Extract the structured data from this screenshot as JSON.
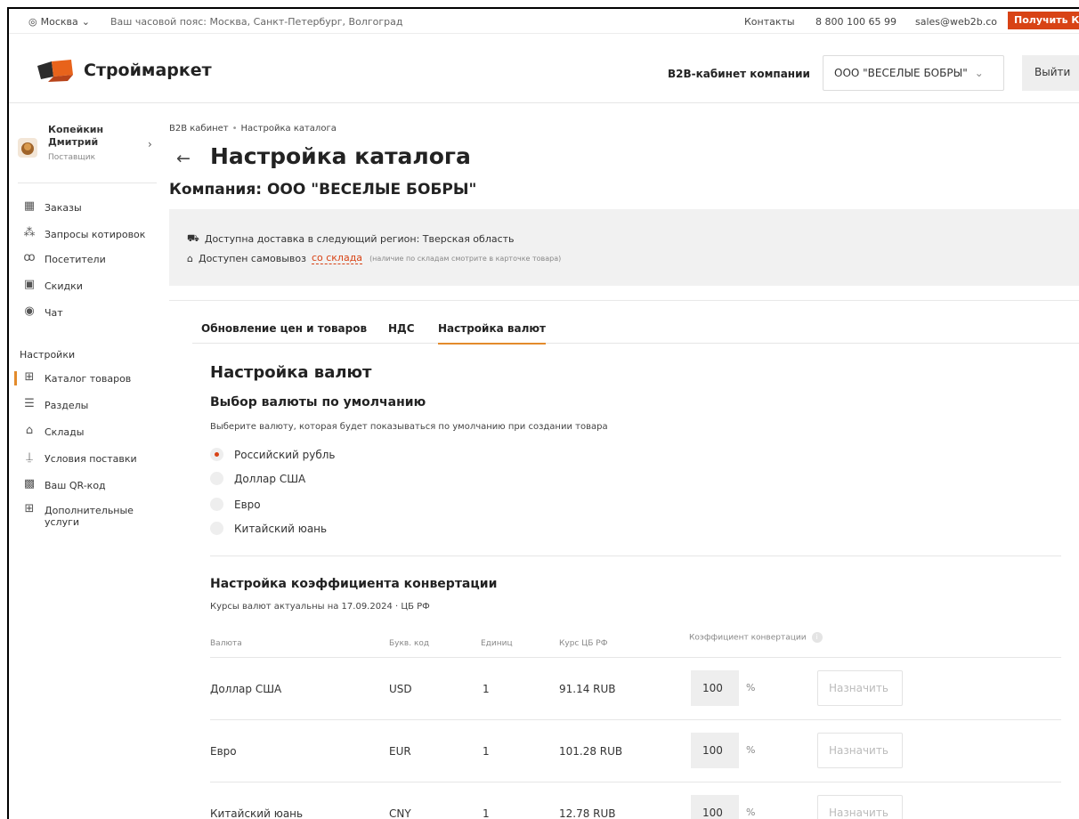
{
  "topbar": {
    "city": "Москва",
    "timezone": "Ваш часовой пояс: Москва, Санкт-Петербург, Волгоград",
    "contacts": "Контакты",
    "phone": "8 800 100 65 99",
    "email": "sales@web2b.co",
    "get_quote": "Получить КП"
  },
  "header": {
    "brand": "Строймаркет",
    "cabinet_label": "B2B-кабинет компании",
    "company_select": "ООО \"ВЕСЕЛЫЕ БОБРЫ\"",
    "logout": "Выйти"
  },
  "sidebar": {
    "user_name": "Копейкин Дмитрий",
    "user_role": "Поставщик",
    "main_items": [
      {
        "label": "Заказы",
        "icon": "orders-icon"
      },
      {
        "label": "Запросы котировок",
        "icon": "quotes-icon"
      },
      {
        "label": "Посетители",
        "icon": "visitors-icon"
      },
      {
        "label": "Скидки",
        "icon": "discounts-icon"
      },
      {
        "label": "Чат",
        "icon": "chat-icon"
      }
    ],
    "settings_title": "Настройки",
    "settings_items": [
      {
        "label": "Каталог товаров",
        "icon": "catalog-icon",
        "active": true
      },
      {
        "label": "Разделы",
        "icon": "sections-icon"
      },
      {
        "label": "Склады",
        "icon": "warehouse-icon"
      },
      {
        "label": "Условия поставки",
        "icon": "delivery-terms-icon"
      },
      {
        "label": "Ваш QR-код",
        "icon": "qr-code-icon"
      },
      {
        "label": "Дополнительные услуги",
        "icon": "services-icon"
      }
    ]
  },
  "breadcrumb": [
    "B2B кабинет",
    "Настройка каталога"
  ],
  "page_title": "Настройка каталога",
  "company_title": "Компания: ООО \"ВЕСЕЛЫЕ БОБРЫ\"",
  "delivery": {
    "region_text": "Доступна доставка в следующий регион: Тверская область",
    "pickup_text": "Доступен самовывоз",
    "pickup_link": "со склада",
    "pickup_note": "(наличие по складам смотрите в карточке товара)"
  },
  "tabs": [
    {
      "label": "Обновление цен и товаров"
    },
    {
      "label": "НДС"
    },
    {
      "label": "Настройка валют",
      "active": true
    }
  ],
  "currency_settings": {
    "title": "Настройка валют",
    "default_title": "Выбор валюты по умолчанию",
    "default_hint": "Выберите валюту, которая будет показываться по умолчанию при создании товара",
    "options": [
      {
        "label": "Российский рубль",
        "selected": true
      },
      {
        "label": "Доллар США",
        "selected": false
      },
      {
        "label": "Евро",
        "selected": false
      },
      {
        "label": "Китайский юань",
        "selected": false
      }
    ],
    "conversion_title": "Настройка коэффициента конвертации",
    "rates_note": "Курсы валют актуальны на 17.09.2024 · ЦБ РФ",
    "columns": {
      "currency": "Валюта",
      "code": "Букв. код",
      "units": "Единиц",
      "rate": "Курс ЦБ РФ",
      "coefficient": "Коэффициент конвертации"
    },
    "rows": [
      {
        "currency": "Доллар США",
        "code": "USD",
        "units": "1",
        "rate": "91.14 RUB",
        "coefficient": "100",
        "percent": "%",
        "assign": "Назначить"
      },
      {
        "currency": "Евро",
        "code": "EUR",
        "units": "1",
        "rate": "101.28 RUB",
        "coefficient": "100",
        "percent": "%",
        "assign": "Назначить"
      },
      {
        "currency": "Китайский юань",
        "code": "CNY",
        "units": "1",
        "rate": "12.78 RUB",
        "coefficient": "100",
        "percent": "%",
        "assign": "Назначить"
      }
    ]
  },
  "colors": {
    "accent": "#e38b2c",
    "brand_red": "#d84315"
  }
}
